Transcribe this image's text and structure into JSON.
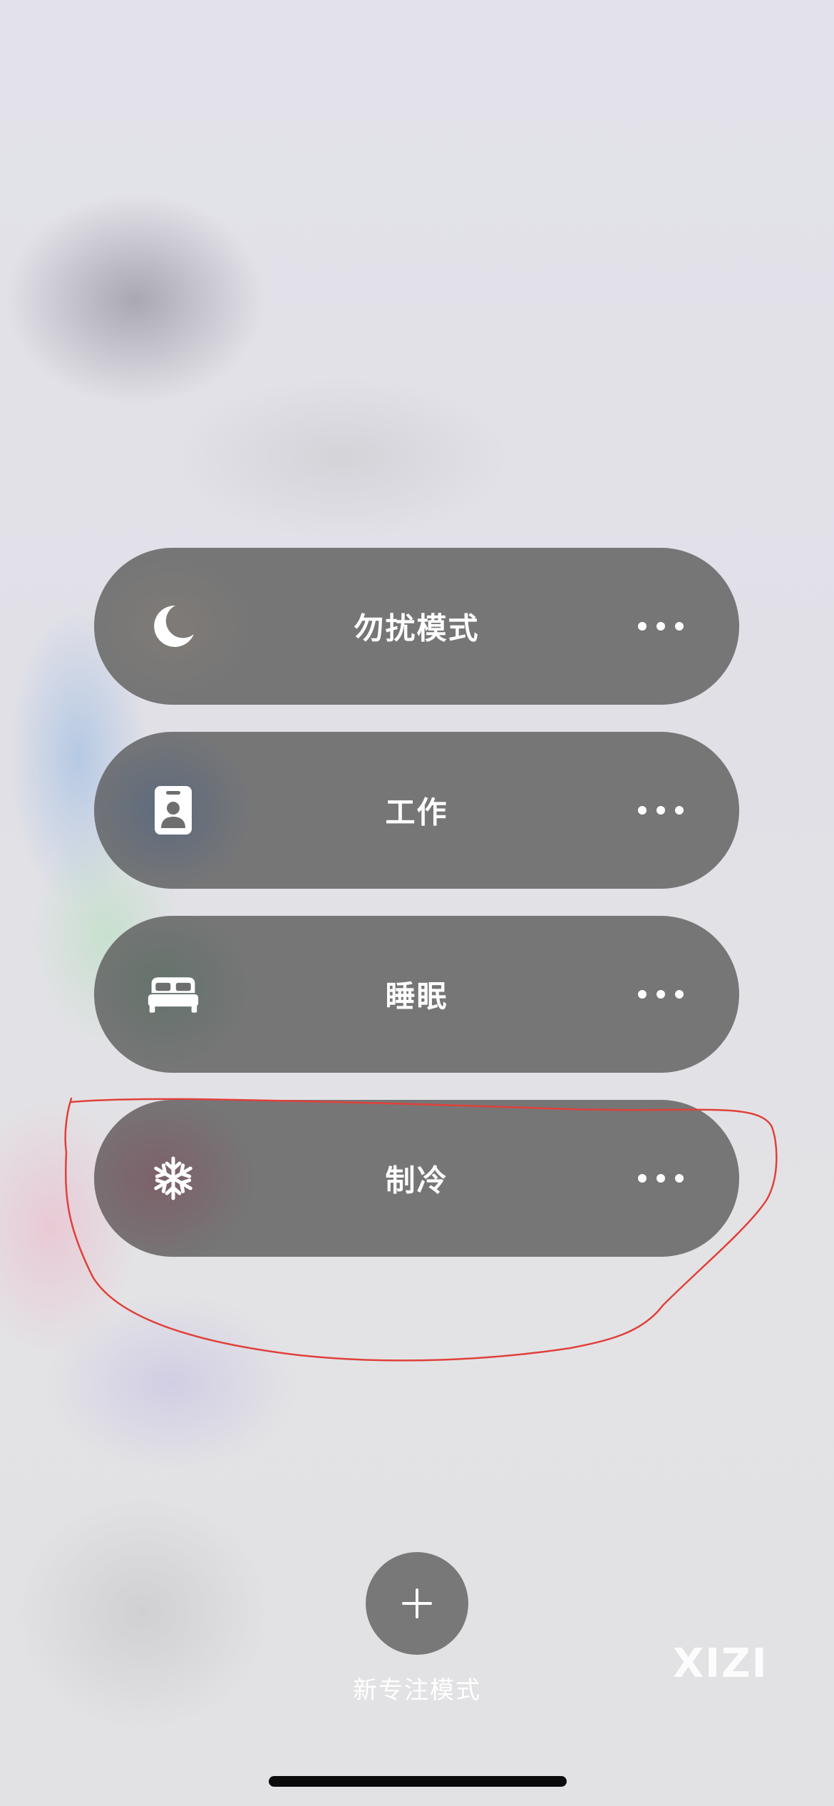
{
  "focus_modes": [
    {
      "label": "勿扰模式",
      "icon": "moon-icon"
    },
    {
      "label": "工作",
      "icon": "id-badge-icon"
    },
    {
      "label": "睡眠",
      "icon": "bed-icon"
    },
    {
      "label": "制冷",
      "icon": "snowflake-icon"
    }
  ],
  "add_focus": {
    "icon": "plus-icon",
    "label": "新专注模式"
  },
  "more_icon": "ellipsis-icon",
  "watermark": "XIZI",
  "colors": {
    "pill": "#6e6e6e",
    "text": "#ffffff",
    "annotation": "#e0403a",
    "background": "#e3e2e8"
  }
}
